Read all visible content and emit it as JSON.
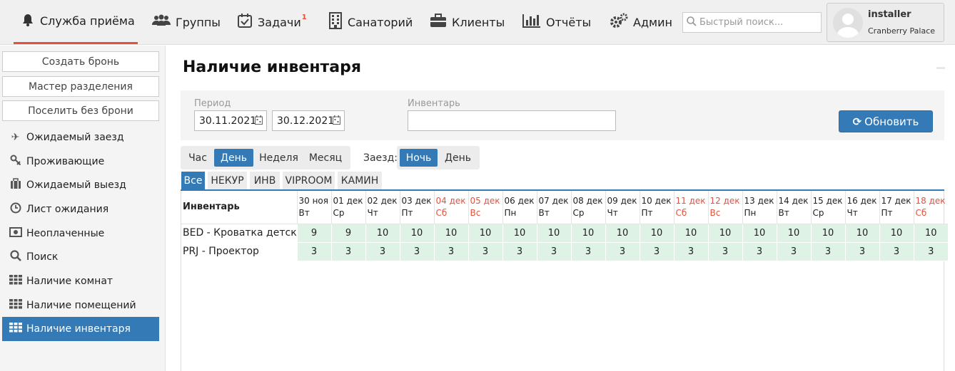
{
  "nav": {
    "items": [
      {
        "label": "Служба приёма",
        "icon": "bell-icon"
      },
      {
        "label": "Группы",
        "icon": "users-icon"
      },
      {
        "label": "Задачи",
        "icon": "tasks-icon",
        "badge": "1"
      },
      {
        "label": "Санаторий",
        "icon": "building-icon"
      },
      {
        "label": "Клиенты",
        "icon": "briefcase-icon"
      },
      {
        "label": "Отчёты",
        "icon": "bar-chart-icon"
      },
      {
        "label": "Админ",
        "icon": "gears-icon"
      }
    ],
    "search_placeholder": "Быстрый поиск...",
    "user_name": "installer",
    "user_hotel": "Cranberry Palace",
    "accent": "#e2533f"
  },
  "sidebar": {
    "buttons": [
      "Создать бронь",
      "Мастер разделения",
      "Поселить без брони"
    ],
    "items": [
      {
        "label": "Ожидаемый заезд",
        "icon": "plane-icon"
      },
      {
        "label": "Проживающие",
        "icon": "key-icon"
      },
      {
        "label": "Ожидаемый выезд",
        "icon": "suitcase-icon"
      },
      {
        "label": "Лист ожидания",
        "icon": "clock-icon"
      },
      {
        "label": "Неоплаченные",
        "icon": "money-icon"
      },
      {
        "label": "Поиск",
        "icon": "search-icon"
      },
      {
        "label": "Наличие комнат",
        "icon": "grid-icon"
      },
      {
        "label": "Наличие помещений",
        "icon": "grid-icon"
      },
      {
        "label": "Наличие инвентаря",
        "icon": "grid-icon"
      }
    ],
    "active_color": "#337ab7"
  },
  "main": {
    "title": "Наличие инвентаря",
    "period_label": "Период",
    "date_from": "30.11.2021",
    "date_to": "30.12.2021",
    "inventory_label": "Инвентарь",
    "inventory_value": "",
    "refresh_label": "Обновить",
    "scale_options": [
      "Час",
      "День",
      "Неделя",
      "Месяц"
    ],
    "scale_selected": "День",
    "checkin_label": "Заезд:",
    "checkin_options": [
      "Ночь",
      "День"
    ],
    "checkin_selected": "Ночь",
    "tabs": [
      "Все",
      "НЕКУР",
      "ИНВ",
      "VIPROOM",
      "КАМИН"
    ],
    "tab_selected": "Все"
  },
  "table": {
    "header_label": "Инвентарь",
    "days": [
      {
        "date": "30 ноя",
        "dow": "Вт",
        "weekend": false
      },
      {
        "date": "01 дек",
        "dow": "Ср",
        "weekend": false
      },
      {
        "date": "02 дек",
        "dow": "Чт",
        "weekend": false
      },
      {
        "date": "03 дек",
        "dow": "Пт",
        "weekend": false
      },
      {
        "date": "04 дек",
        "dow": "Сб",
        "weekend": true
      },
      {
        "date": "05 дек",
        "dow": "Вс",
        "weekend": true
      },
      {
        "date": "06 дек",
        "dow": "Пн",
        "weekend": false
      },
      {
        "date": "07 дек",
        "dow": "Вт",
        "weekend": false
      },
      {
        "date": "08 дек",
        "dow": "Ср",
        "weekend": false
      },
      {
        "date": "09 дек",
        "dow": "Чт",
        "weekend": false
      },
      {
        "date": "10 дек",
        "dow": "Пт",
        "weekend": false
      },
      {
        "date": "11 дек",
        "dow": "Сб",
        "weekend": true
      },
      {
        "date": "12 дек",
        "dow": "Вс",
        "weekend": true
      },
      {
        "date": "13 дек",
        "dow": "Пн",
        "weekend": false
      },
      {
        "date": "14 дек",
        "dow": "Вт",
        "weekend": false
      },
      {
        "date": "15 дек",
        "dow": "Ср",
        "weekend": false
      },
      {
        "date": "16 дек",
        "dow": "Чт",
        "weekend": false
      },
      {
        "date": "17 дек",
        "dow": "Пт",
        "weekend": false
      },
      {
        "date": "18 дек",
        "dow": "Сб",
        "weekend": true
      }
    ],
    "rows": [
      {
        "name": "BED - Кроватка детская",
        "values": [
          "9",
          "9",
          "10",
          "10",
          "10",
          "10",
          "10",
          "10",
          "10",
          "10",
          "10",
          "10",
          "10",
          "10",
          "10",
          "10",
          "10",
          "10",
          "10"
        ]
      },
      {
        "name": "PRJ - Проектор",
        "values": [
          "3",
          "3",
          "3",
          "3",
          "3",
          "3",
          "3",
          "3",
          "3",
          "3",
          "3",
          "3",
          "3",
          "3",
          "3",
          "3",
          "3",
          "3",
          "3"
        ]
      }
    ],
    "available_color": "#def3e6"
  }
}
